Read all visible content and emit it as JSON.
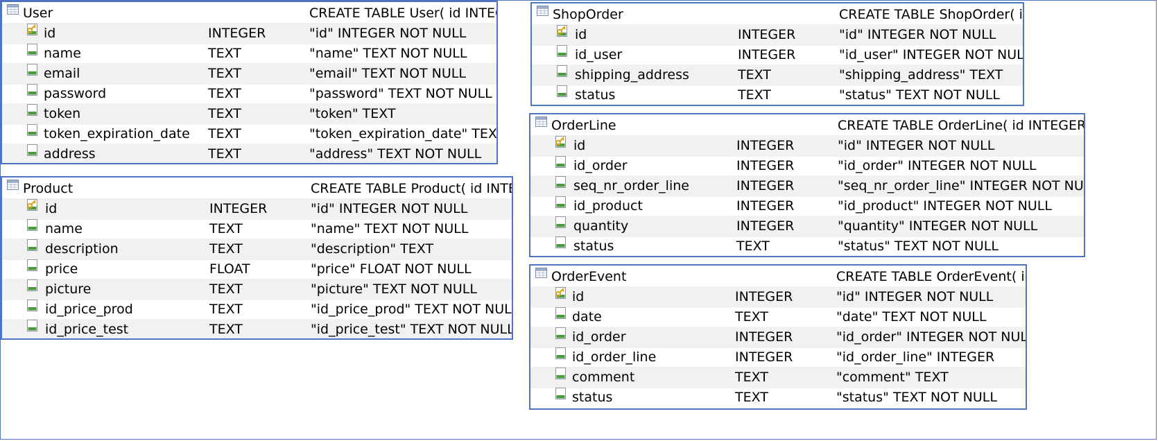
{
  "tables": [
    {
      "name": "User",
      "sql": "CREATE TABLE User( id INTEGER",
      "columns": [
        {
          "name": "id",
          "type": "INTEGER",
          "def": "\"id\" INTEGER NOT NULL",
          "key": true
        },
        {
          "name": "name",
          "type": "TEXT",
          "def": "\"name\" TEXT NOT NULL"
        },
        {
          "name": "email",
          "type": "TEXT",
          "def": "\"email\" TEXT NOT NULL"
        },
        {
          "name": "password",
          "type": "TEXT",
          "def": "\"password\" TEXT NOT NULL"
        },
        {
          "name": "token",
          "type": "TEXT",
          "def": "\"token\" TEXT"
        },
        {
          "name": "token_expiration_date",
          "type": "TEXT",
          "def": "\"token_expiration_date\" TEXT"
        },
        {
          "name": "address",
          "type": "TEXT",
          "def": "\"address\" TEXT NOT NULL"
        }
      ]
    },
    {
      "name": "Product",
      "sql": "CREATE TABLE Product( id INTEGER",
      "columns": [
        {
          "name": "id",
          "type": "INTEGER",
          "def": "\"id\" INTEGER NOT NULL",
          "key": true
        },
        {
          "name": "name",
          "type": "TEXT",
          "def": "\"name\" TEXT NOT NULL"
        },
        {
          "name": "description",
          "type": "TEXT",
          "def": "\"description\" TEXT"
        },
        {
          "name": "price",
          "type": "FLOAT",
          "def": "\"price\" FLOAT NOT NULL"
        },
        {
          "name": "picture",
          "type": "TEXT",
          "def": "\"picture\" TEXT NOT NULL"
        },
        {
          "name": "id_price_prod",
          "type": "TEXT",
          "def": "\"id_price_prod\" TEXT NOT NULL"
        },
        {
          "name": "id_price_test",
          "type": "TEXT",
          "def": "\"id_price_test\" TEXT NOT NULL"
        }
      ]
    },
    {
      "name": "ShopOrder",
      "sql": "CREATE TABLE ShopOrder( id",
      "columns": [
        {
          "name": "id",
          "type": "INTEGER",
          "def": "\"id\" INTEGER NOT NULL",
          "key": true
        },
        {
          "name": "id_user",
          "type": "INTEGER",
          "def": "\"id_user\" INTEGER NOT NULL"
        },
        {
          "name": "shipping_address",
          "type": "TEXT",
          "def": "\"shipping_address\" TEXT"
        },
        {
          "name": "status",
          "type": "TEXT",
          "def": "\"status\" TEXT NOT NULL"
        }
      ]
    },
    {
      "name": "OrderLine",
      "sql": "CREATE TABLE OrderLine( id INTEGER NOT",
      "columns": [
        {
          "name": "id",
          "type": "INTEGER",
          "def": "\"id\" INTEGER NOT NULL",
          "key": true
        },
        {
          "name": "id_order",
          "type": "INTEGER",
          "def": "\"id_order\" INTEGER NOT NULL"
        },
        {
          "name": "seq_nr_order_line",
          "type": "INTEGER",
          "def": "\"seq_nr_order_line\" INTEGER NOT NULL"
        },
        {
          "name": "id_product",
          "type": "INTEGER",
          "def": "\"id_product\" INTEGER NOT NULL"
        },
        {
          "name": "quantity",
          "type": "INTEGER",
          "def": "\"quantity\" INTEGER NOT NULL"
        },
        {
          "name": "status",
          "type": "TEXT",
          "def": "\"status\" TEXT NOT NULL"
        }
      ]
    },
    {
      "name": "OrderEvent",
      "sql": "CREATE TABLE OrderEvent( id",
      "columns": [
        {
          "name": "id",
          "type": "INTEGER",
          "def": "\"id\" INTEGER NOT NULL",
          "key": true
        },
        {
          "name": "date",
          "type": "TEXT",
          "def": "\"date\" TEXT NOT NULL"
        },
        {
          "name": "id_order",
          "type": "INTEGER",
          "def": "\"id_order\" INTEGER NOT NULL"
        },
        {
          "name": "id_order_line",
          "type": "INTEGER",
          "def": "\"id_order_line\" INTEGER"
        },
        {
          "name": "comment",
          "type": "TEXT",
          "def": "\"comment\" TEXT"
        },
        {
          "name": "status",
          "type": "TEXT",
          "def": "\"status\" TEXT NOT NULL"
        }
      ]
    }
  ],
  "icons": {
    "table": "table-icon",
    "field": "field-icon",
    "key": "primary-key-icon"
  },
  "colors": {
    "border": "#4f74c4",
    "row_alt": "#f1f1f1",
    "field_icon": "#4a9a3e",
    "key_icon": "#d8a21b"
  }
}
